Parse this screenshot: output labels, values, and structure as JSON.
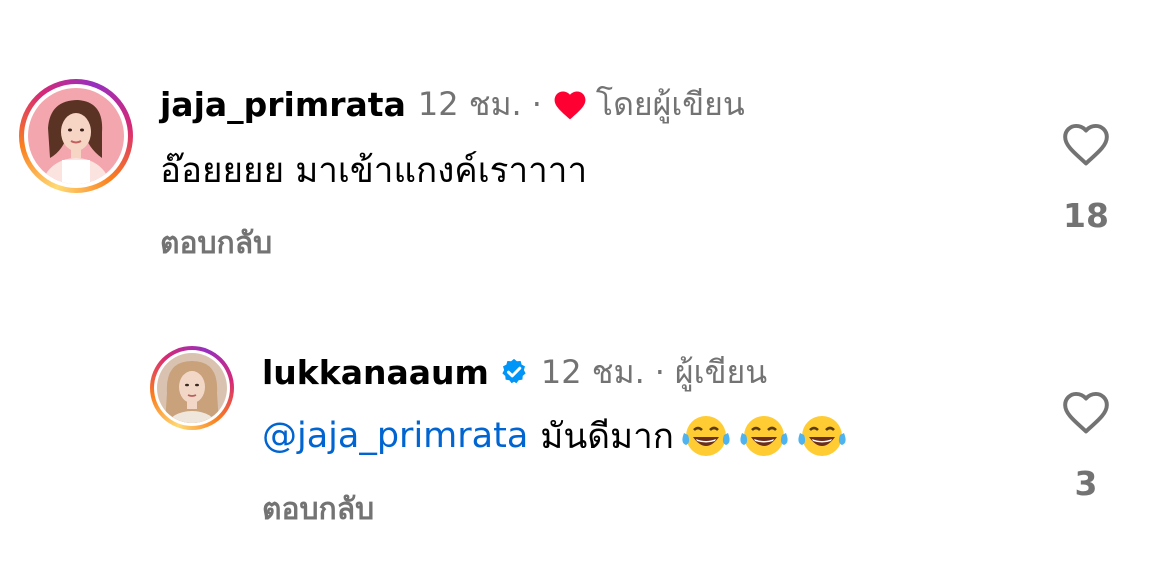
{
  "comments": [
    {
      "username": "jaja_primrata",
      "time": "12 ชม.",
      "separator": "·",
      "author_liked_label": "โดยผู้เขียน",
      "text": "อ๊อยยยย มาเข้าแกงค์เราาาา",
      "reply_label": "ตอบกลับ",
      "like_count": "18",
      "avatar_icon": "avatar-photo-icon",
      "heart_color": "#ff0033"
    },
    {
      "username": "lukkanaaum",
      "verified": true,
      "verified_color": "#0095f6",
      "time": "12 ชม.",
      "separator": "·",
      "author_label": "ผู้เขียน",
      "mention": "@jaja_primrata",
      "text": "มันดีมาก",
      "emojis": [
        "😂",
        "😂",
        "😂"
      ],
      "reply_label": "ตอบกลับ",
      "like_count": "3",
      "avatar_icon": "avatar-photo-icon"
    }
  ],
  "colors": {
    "secondary_text": "#737373",
    "mention": "#0064d1",
    "background": "#ffffff"
  }
}
